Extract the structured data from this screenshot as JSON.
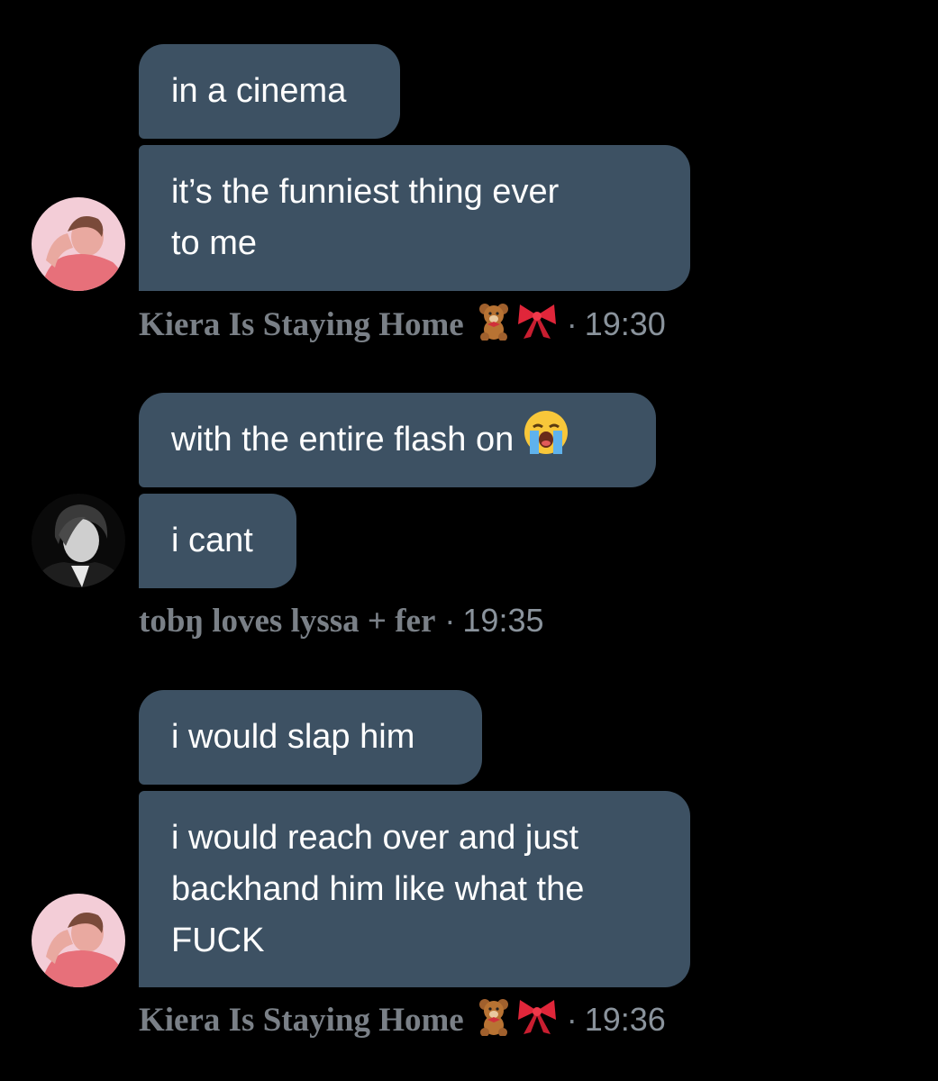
{
  "messages": [
    {
      "sender": "Kiera Is Staying Home",
      "time": "19:30",
      "bubbles": [
        "in a cinema",
        "it’s the funniest thing ever\nto me"
      ]
    },
    {
      "sender": "tobŋ loves lyssa + fer",
      "time": "19:35",
      "bubbles": [
        "with the entire flash on",
        "i cant"
      ]
    },
    {
      "sender": "Kiera Is Staying Home",
      "time": "19:36",
      "bubbles": [
        "i would slap him",
        "i would reach over and just\nbackhand him like what the\nFUCK"
      ]
    }
  ],
  "meta_separator": "·",
  "colors": {
    "background": "#000000",
    "bubble": "#3d5163",
    "meta_text": "#7f8891"
  },
  "icons": [
    "teddy-bear-emoji-icon",
    "ribbon-emoji-icon",
    "crying-face-emoji-icon"
  ]
}
